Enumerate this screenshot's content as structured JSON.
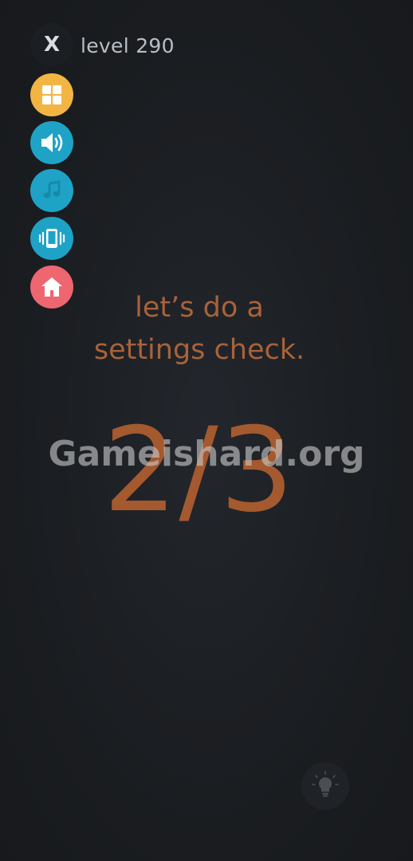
{
  "header": {
    "close_label": "X",
    "level_label": "level 290"
  },
  "side_menu": {
    "items": [
      {
        "name": "menu",
        "icon": "grid-icon",
        "color": "#f2b544"
      },
      {
        "name": "sound",
        "icon": "speaker-icon",
        "color": "#1ea3c7"
      },
      {
        "name": "music",
        "icon": "music-note-icon",
        "color": "#1ea3c7"
      },
      {
        "name": "vibration",
        "icon": "vibrate-icon",
        "color": "#1ea3c7"
      },
      {
        "name": "home",
        "icon": "home-icon",
        "color": "#ee6670"
      }
    ]
  },
  "puzzle": {
    "prompt_line1": "let’s do a",
    "prompt_line2": "settings check.",
    "progress_text": "2/3"
  },
  "watermark": "Gameishard.org",
  "hint": {
    "icon": "lightbulb-icon"
  },
  "colors": {
    "background": "#1c1f23",
    "accent_text": "#a8623a",
    "menu_yellow": "#f2b544",
    "toggle_blue": "#1ea3c7",
    "home_red": "#ee6670"
  }
}
